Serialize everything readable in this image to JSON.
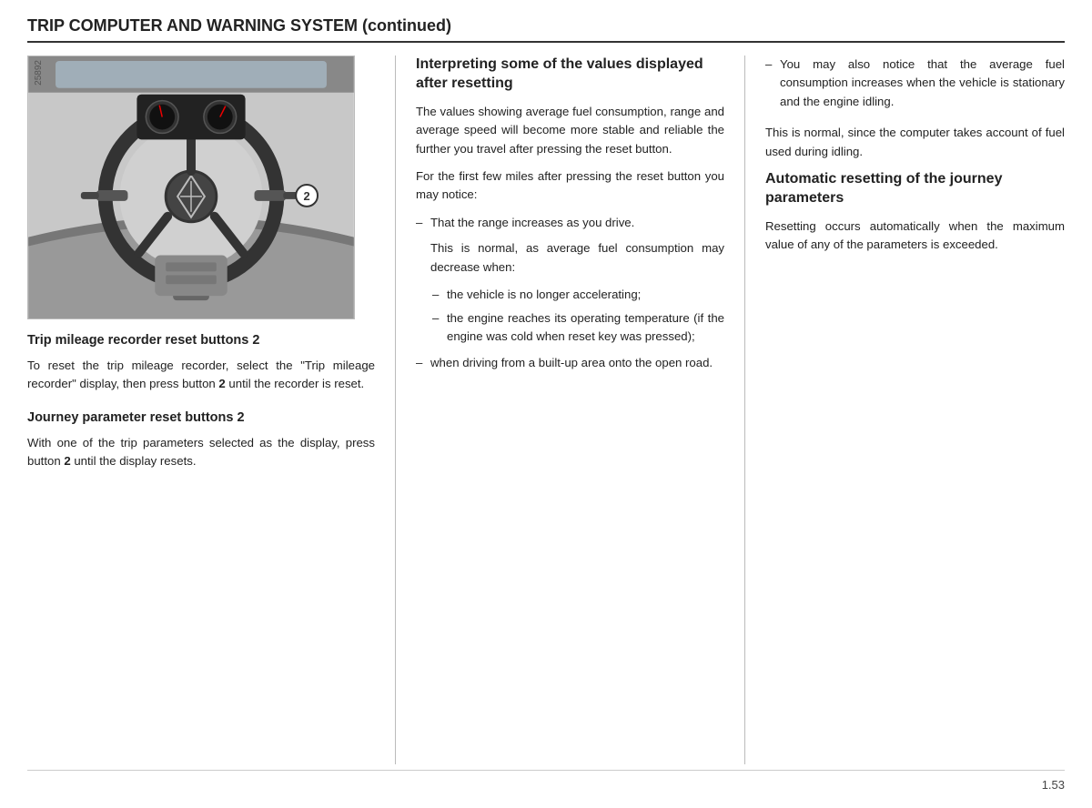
{
  "page": {
    "title": "TRIP COMPUTER AND WARNING SYSTEM (continued)",
    "page_number": "1.53",
    "image_label": "25892"
  },
  "col1": {
    "section1": {
      "heading": "Trip mileage recorder reset buttons 2",
      "body": "To reset the trip mileage recorder, select the \"Trip mileage recorder\" display, then press button ",
      "body_bold": "2",
      "body_end": " until the recorder is reset."
    },
    "section2": {
      "heading": "Journey parameter reset buttons 2",
      "body": "With one of the trip parameters selected as the display, press button ",
      "body_bold": "2",
      "body_end": " until the display resets."
    }
  },
  "col2": {
    "heading": "Interpreting some of the values displayed after resetting",
    "para1": "The values showing average fuel consumption, range and average speed will become more stable and reliable the further you travel after pressing the reset button.",
    "para2": "For the first few miles after pressing the reset button you may notice:",
    "bullet1": "That the range increases as you drive.",
    "sub_para1": "This is normal, as average fuel consumption may decrease when:",
    "sub_bullet1": "the vehicle is no longer accelerating;",
    "sub_bullet2": "the engine reaches its operating temperature (if the engine was cold when reset key was pressed);",
    "bullet2": "when driving from a built-up area onto the open road."
  },
  "col3": {
    "bullet_text": "You may also notice that the average fuel consumption increases when the vehicle is stationary and the engine idling.",
    "normal_text": "This is normal, since the computer takes account of fuel used during idling.",
    "auto_heading": "Automatic resetting of the journey parameters",
    "auto_body": "Resetting occurs automatically when the maximum value of any of the parameters is exceeded."
  }
}
